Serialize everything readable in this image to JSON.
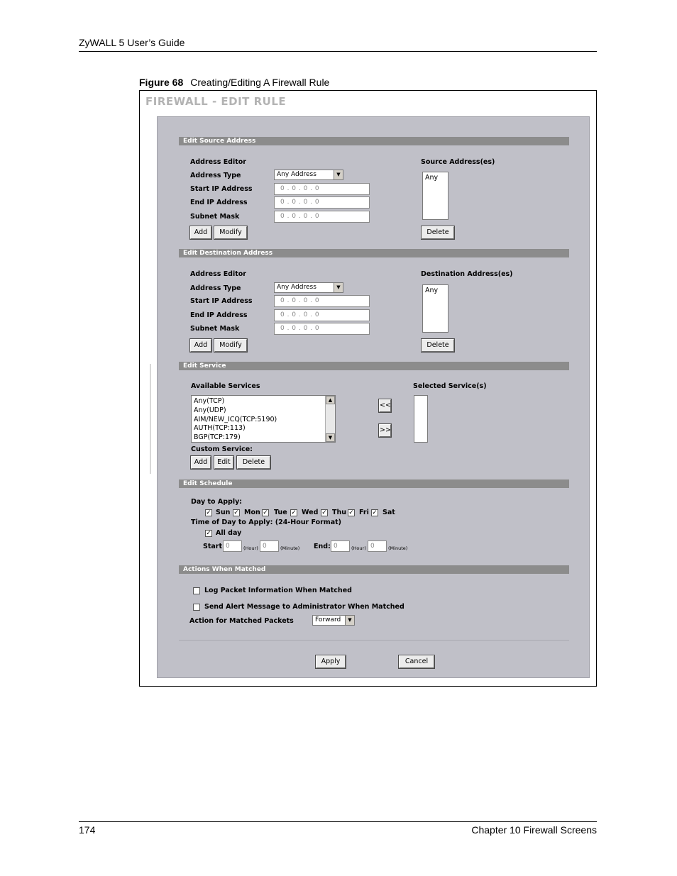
{
  "doc": {
    "header": "ZyWALL 5 User’s Guide",
    "figure_label": "Figure 68",
    "figure_title": "Creating/Editing A Firewall Rule",
    "page_number": "174",
    "chapter": "Chapter 10 Firewall Screens"
  },
  "screen": {
    "title": "FIREWALL - EDIT RULE",
    "source": {
      "section_title": "Edit Source Address",
      "editor_label": "Address Editor",
      "type_label": "Address Type",
      "type_value": "Any Address",
      "start_label": "Start IP Address",
      "end_label": "End IP Address",
      "mask_label": "Subnet Mask",
      "ip_placeholder": "0 . 0 . 0 . 0",
      "add": "Add",
      "modify": "Modify",
      "list_label": "Source Address(es)",
      "list_item": "Any",
      "delete": "Delete"
    },
    "destination": {
      "section_title": "Edit Destination Address",
      "editor_label": "Address Editor",
      "type_label": "Address Type",
      "type_value": "Any Address",
      "start_label": "Start IP Address",
      "end_label": "End IP Address",
      "mask_label": "Subnet Mask",
      "ip_placeholder": "0 . 0 . 0 . 0",
      "add": "Add",
      "modify": "Modify",
      "list_label": "Destination Address(es)",
      "list_item": "Any",
      "delete": "Delete"
    },
    "service": {
      "section_title": "Edit Service",
      "available_label": "Available Services",
      "available": [
        "Any(TCP)",
        "Any(UDP)",
        "AIM/NEW_ICQ(TCP:5190)",
        "AUTH(TCP:113)",
        "BGP(TCP:179)"
      ],
      "selected_label": "Selected Service(s)",
      "move_left": "<<",
      "move_right": ">>",
      "custom_label": "Custom Service:",
      "add": "Add",
      "edit": "Edit",
      "delete": "Delete"
    },
    "schedule": {
      "section_title": "Edit Schedule",
      "day_label": "Day to Apply:",
      "days": [
        "Sun",
        "Mon",
        "Tue",
        "Wed",
        "Thu",
        "Fri",
        "Sat"
      ],
      "time_label": "Time of Day to Apply: (24-Hour Format)",
      "all_day": "All day",
      "start_label": "Start:",
      "end_label": "End:",
      "hour": "(Hour)",
      "minute": "(Minute)",
      "start_hour": "0",
      "start_minute": "0",
      "end_hour": "0",
      "end_minute": "0"
    },
    "actions": {
      "section_title": "Actions When Matched",
      "log_label": "Log Packet Information When Matched",
      "alert_label": "Send Alert Message to Administrator When Matched",
      "action_label": "Action for Matched Packets",
      "action_value": "Forward"
    },
    "apply": "Apply",
    "cancel": "Cancel"
  }
}
